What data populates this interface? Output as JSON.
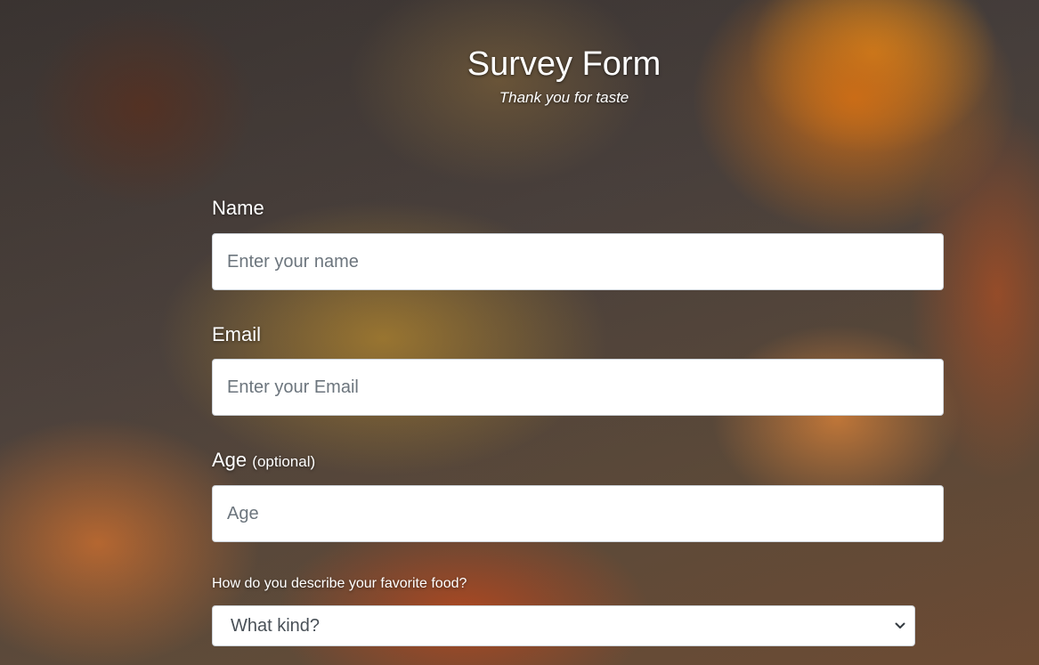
{
  "header": {
    "title": "Survey Form",
    "subtitle": "Thank you for taste"
  },
  "form": {
    "name": {
      "label": "Name",
      "placeholder": "Enter your name",
      "value": ""
    },
    "email": {
      "label": "Email",
      "placeholder": "Enter your Email",
      "value": ""
    },
    "age": {
      "label": "Age",
      "optional_note": "(optional)",
      "placeholder": "Age",
      "value": ""
    },
    "food": {
      "label": "How do you describe your favorite food?",
      "selected": "What kind?"
    }
  },
  "icons": {
    "select_arrow": "chevron-down-icon"
  }
}
